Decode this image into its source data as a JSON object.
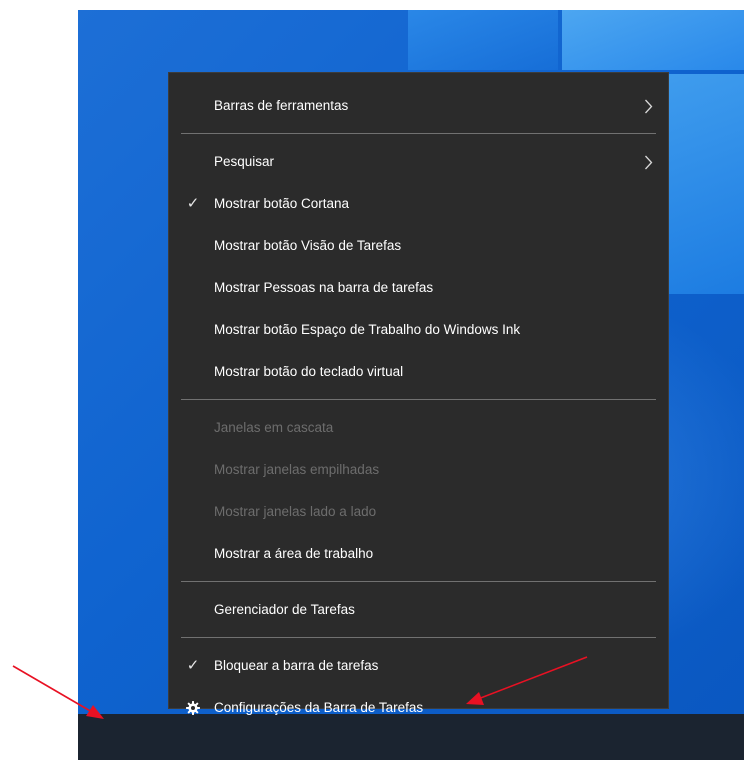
{
  "menu": {
    "items": [
      {
        "label": "Barras de ferramentas"
      },
      {
        "label": "Pesquisar"
      },
      {
        "label": "Mostrar botão Cortana"
      },
      {
        "label": "Mostrar botão Visão de Tarefas"
      },
      {
        "label": "Mostrar Pessoas na barra de tarefas"
      },
      {
        "label": "Mostrar botão Espaço de Trabalho do Windows Ink"
      },
      {
        "label": "Mostrar botão do teclado virtual"
      },
      {
        "label": "Janelas em cascata"
      },
      {
        "label": "Mostrar janelas empilhadas"
      },
      {
        "label": "Mostrar janelas lado a lado"
      },
      {
        "label": "Mostrar a área de trabalho"
      },
      {
        "label": "Gerenciador de Tarefas"
      },
      {
        "label": "Bloquear a barra de tarefas"
      },
      {
        "label": "Configurações da Barra de Tarefas"
      }
    ],
    "checked_items": [
      "Mostrar botão Cortana",
      "Bloquear a barra de tarefas"
    ],
    "disabled_items": [
      "Janelas em cascata",
      "Mostrar janelas empilhadas",
      "Mostrar janelas lado a lado"
    ],
    "submenu_items": [
      "Barras de ferramentas",
      "Pesquisar"
    ],
    "check_glyph": "✓",
    "icons": {
      "submenu": "chevron-right-icon",
      "check": "checkmark-icon",
      "settings": "gear-icon"
    }
  },
  "colors": {
    "menu_bg": "#2b2b2b",
    "menu_text": "#ffffff",
    "disabled_text": "#6d6d6d",
    "separator": "#717171",
    "desktop_blue": "#0f63cf",
    "taskbar": "#1b2430",
    "annotation_arrow": "#e81123"
  }
}
